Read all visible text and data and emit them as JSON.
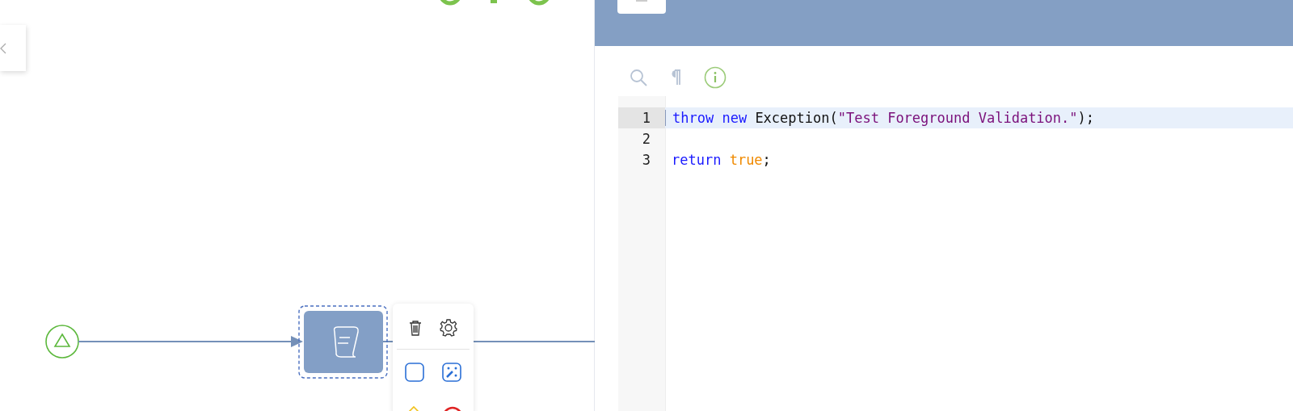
{
  "editor": {
    "lines": [
      {
        "number": "1",
        "active": true,
        "tokens": [
          {
            "text": "throw",
            "kind": "keyword"
          },
          {
            "text": " new",
            "kind": "keyword"
          },
          {
            "text": " Exception(",
            "kind": "plain"
          },
          {
            "text": "\"Test Foreground Validation.\"",
            "kind": "string"
          },
          {
            "text": ");",
            "kind": "plain"
          }
        ]
      },
      {
        "number": "2",
        "active": false
      },
      {
        "number": "3",
        "active": false,
        "tokens": [
          {
            "text": "return",
            "kind": "keyword"
          },
          {
            "text": " true",
            "kind": "atom"
          },
          {
            "text": ";",
            "kind": "plain"
          }
        ]
      }
    ]
  }
}
